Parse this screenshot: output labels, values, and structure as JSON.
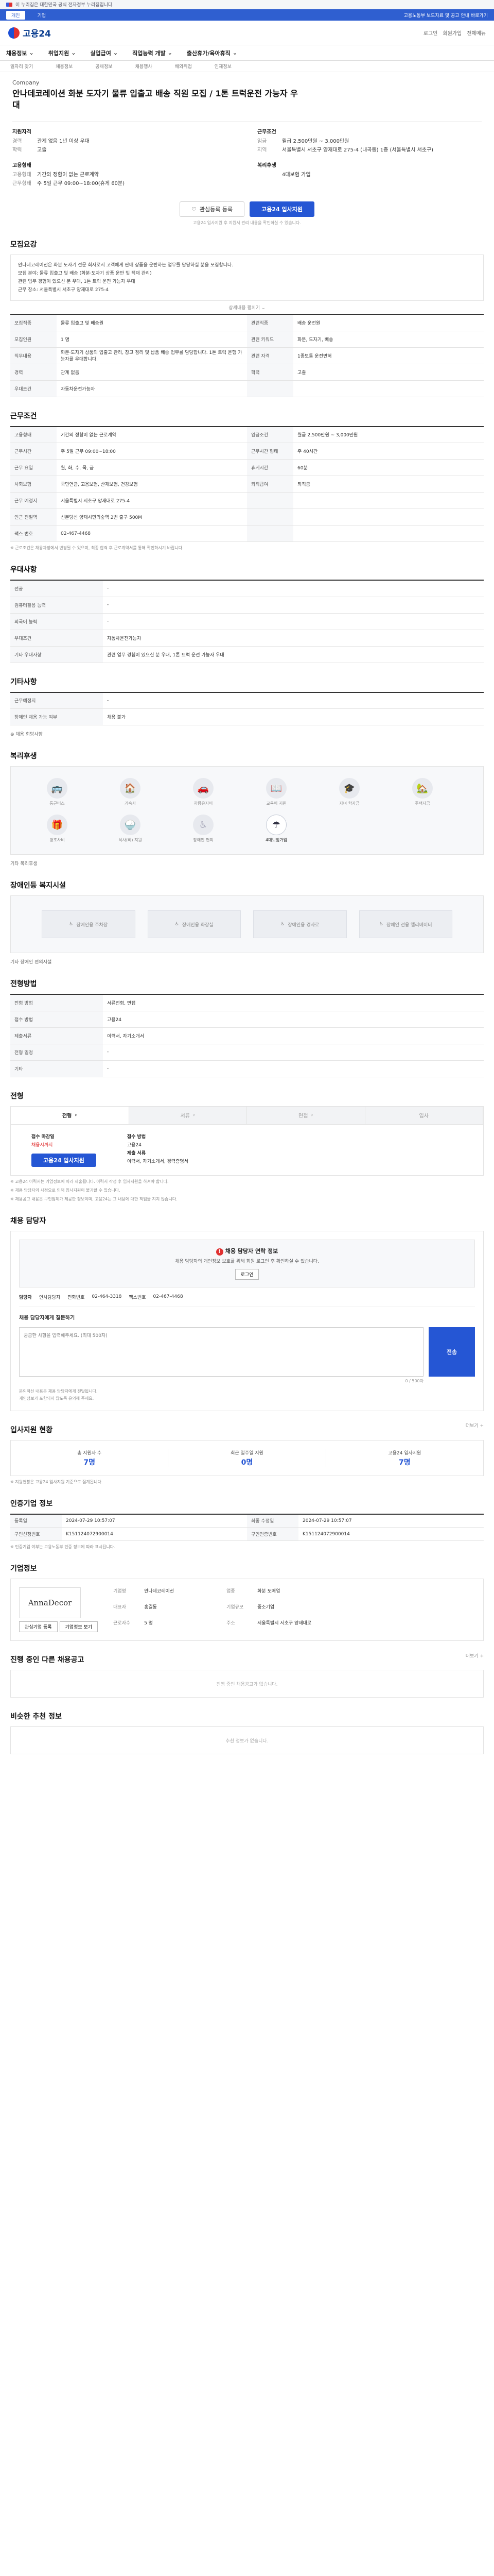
{
  "gov": {
    "notice": "이 누리집은 대한민국 공식 전자정부 누리집입니다."
  },
  "notice_bar": {
    "tabs": [
      "개인",
      "기업"
    ],
    "right": "고용노동부 보도자료 및 공고 안내 바로가기"
  },
  "header": {
    "logo": "고용24",
    "links": [
      "로그인",
      "회원가입",
      "전체메뉴"
    ]
  },
  "gnb": [
    "채용정보",
    "취업지원",
    "실업급여",
    "직업능력 개발",
    "출산휴가/육아휴직"
  ],
  "subnav": [
    "일자리 찾기",
    "채용정보",
    "공채정보",
    "채용행사",
    "해외취업",
    "인재정보"
  ],
  "job": {
    "company": "Company",
    "title": "안나데코레이션 화분 도자기 물류 입출고 배송 직원 모집 / 1톤 트럭운전 가능자 우대"
  },
  "summary": {
    "left": [
      {
        "head": "지원자격",
        "rows": [
          [
            "경력",
            "관계 없음 1년 이상 우대"
          ],
          [
            "학력",
            "고졸"
          ]
        ]
      },
      {
        "head": "고용형태",
        "rows": [
          [
            "고용형태",
            "기간의 정함이 없는 근로계약"
          ],
          [
            "근무형태",
            "주 5일 근무 09:00~18:00(휴게 60분)"
          ]
        ]
      }
    ],
    "right": [
      {
        "head": "근무조건",
        "rows": [
          [
            "임금",
            "월급 2,500만원 ~ 3,000만원"
          ],
          [
            "지역",
            "서울특별시 서초구 양재대로 275-4 (내곡동) 1층 (서울특별시 서초구)"
          ]
        ]
      },
      {
        "head": "복리후생",
        "rows": [
          [
            "",
            "4대보험 가입"
          ]
        ]
      }
    ]
  },
  "actions": {
    "favorite": "관심등록 등록",
    "apply": "고용24 입사지원",
    "note": "고용24 입사지원 후 지원서 관리 내용을 확인하실 수 있습니다."
  },
  "sections": {
    "recruit": "모집요강",
    "work": "근무조건",
    "prefer": "우대사항",
    "etc": "기타사항",
    "welfare": "복리후생",
    "disabled": "장애인등 복지시설",
    "process": "전형방법",
    "contact": "채용 담당자",
    "stats": "입사지원 현황",
    "info": "인증기업 정보",
    "company": "기업정보",
    "same": "진행 중인 다른 채용공고",
    "similar": "비슷한 추천 정보"
  },
  "recruit_detail": {
    "lines": [
      "안나데코레이션은 화분 도자기 전문 회사로서 고객에게 판매 상품을 운반하는 업무를 담당하실 분을 모집합니다.",
      "모집 분야: 물류 입출고 및 배송 (화분·도자기 상품 운반 및 적재 관리)",
      "관련 업무 경험이 있으신 분 우대, 1톤 트럭 운전 가능자 우대",
      "근무 장소: 서울특별시 서초구 양재대로 275-4"
    ],
    "expand": "상세내용 펼치기"
  },
  "recruit_table": [
    [
      [
        "모집직종",
        "물류 입출고 및 배송원"
      ],
      [
        "관련직종",
        "배송 운전원"
      ]
    ],
    [
      [
        "모집인원",
        "1 명"
      ],
      [
        "관련 키워드",
        "화분, 도자기, 배송"
      ]
    ],
    [
      [
        "직무내용",
        "화분·도자기 상품의 입출고 관리, 창고 정리 및 납품 배송 업무를 담당합니다. 1톤 트럭 운행 가능자를 우대합니다."
      ],
      [
        "관련 자격",
        "1종보통 운전면허"
      ]
    ],
    [
      [
        "경력",
        "관계 없음"
      ],
      [
        "학력",
        "고졸"
      ]
    ],
    [
      [
        "우대조건",
        "자동차운전가능자"
      ],
      [
        "",
        ""
      ]
    ]
  ],
  "work_table": [
    [
      [
        "고용형태",
        "기간의 정함이 없는 근로계약"
      ],
      [
        "임금조건",
        "월급 2,500만원 ~ 3,000만원"
      ]
    ],
    [
      [
        "근무시간",
        "주 5일 근무 09:00~18:00"
      ],
      [
        "근무시간 형태",
        "주 40시간"
      ]
    ],
    [
      [
        "근무 요일",
        "월, 화, 수, 목, 금"
      ],
      [
        "휴게시간",
        "60분"
      ]
    ],
    [
      [
        "사회보험",
        "국민연금, 고용보험, 산재보험, 건강보험"
      ],
      [
        "퇴직급여",
        "퇴직금"
      ]
    ],
    [
      [
        "근무 예정지",
        "서울특별시 서초구 양재대로 275-4"
      ],
      [
        "",
        ""
      ]
    ],
    [
      [
        "인근 전철역",
        "신분당선 양재시민의숲역 2번 출구 500M"
      ],
      [
        "",
        ""
      ]
    ],
    [
      [
        "팩스 번호",
        "02-467-4468"
      ],
      [
        "",
        ""
      ]
    ]
  ],
  "work_note": "※ 근로조건은 채용과정에서 변경될 수 있으며, 최종 합격 후 근로계약서를 통해 확인하시기 바랍니다.",
  "prefer_table": [
    [
      [
        "전공",
        "-"
      ]
    ],
    [
      [
        "컴퓨터활용 능력",
        "-"
      ]
    ],
    [
      [
        "외국어 능력",
        "-"
      ]
    ],
    [
      [
        "우대조건",
        "자동차운전가능자"
      ]
    ],
    [
      [
        "기타 우대사항",
        "관련 업무 경험이 있으신 분 우대, 1톤 트럭 운전 가능자 우대"
      ]
    ]
  ],
  "etc_table": [
    [
      [
        "근무예정지",
        "-"
      ]
    ],
    [
      [
        "장애인 채용 가능 여부",
        "채용 불가"
      ]
    ]
  ],
  "etc_link": "채용 희망사항",
  "welfare_icons": [
    {
      "label": "통근버스",
      "icon": "bus-icon",
      "glyph": "🚌",
      "on": false
    },
    {
      "label": "기숙사",
      "icon": "dorm-icon",
      "glyph": "🏠",
      "on": false
    },
    {
      "label": "차량유지비",
      "icon": "car-icon",
      "glyph": "🚗",
      "on": false
    },
    {
      "label": "교육비 지원",
      "icon": "book-icon",
      "glyph": "📖",
      "on": false
    },
    {
      "label": "자녀 학자금",
      "icon": "cap-icon",
      "glyph": "🎓",
      "on": false
    },
    {
      "label": "주택자금",
      "icon": "house-icon",
      "glyph": "🏡",
      "on": false
    },
    {
      "label": "경조사비",
      "icon": "gift-icon",
      "glyph": "🎁",
      "on": false
    },
    {
      "label": "식사(비) 지원",
      "icon": "meal-icon",
      "glyph": "🍚",
      "on": false
    },
    {
      "label": "장애인 편의",
      "icon": "accessible-icon",
      "glyph": "♿",
      "on": false
    },
    {
      "label": "4대보험가입",
      "icon": "insurance-icon",
      "glyph": "☂",
      "on": true
    }
  ],
  "welfare_etc": "기타 복리후생",
  "facilities": [
    "장애인용 주차장",
    "장애인용 화장실",
    "장애인용 경사로",
    "장애인 전용 엘리베이터"
  ],
  "facilities_etc": "기타 장애인 편의시설",
  "process_table": [
    [
      [
        "전형 방법",
        "서류전형, 면접"
      ]
    ],
    [
      [
        "접수 방법",
        "고용24"
      ]
    ],
    [
      [
        "제출서류",
        "이력서, 자기소개서"
      ]
    ],
    [
      [
        "전형 일정",
        "-"
      ]
    ],
    [
      [
        "기타",
        "-"
      ]
    ]
  ],
  "apply_tabs": [
    "전형",
    "서류",
    "면접",
    "입사"
  ],
  "apply": {
    "h1": "접수 마감일",
    "v1": "채용시까지",
    "h2": "접수 방법",
    "v2": "고용24",
    "h3": "제출 서류",
    "v3": "이력서, 자기소개서, 경력증명서",
    "btn": "고용24 입사지원"
  },
  "apply_notes": [
    "※ 고용24 이력서는 기업정보에 따라 제출됩니다. 이력서 작성 후 입사지원을 하셔야 합니다.",
    "※ 채용 담당자의 사정으로 인해 입사지원이 불가할 수 있습니다.",
    "※ 채용공고 내용은 구인업체가 제공한 정보이며, 고용24는 그 내용에 대한 책임을 지지 않습니다."
  ],
  "contact": {
    "alert_title": "채용 담당자 연락 정보",
    "alert_text": "채용 담당자의 개인정보 보호를 위해 회원 로그인 후 확인하실 수 있습니다.",
    "login_btn": "로그인",
    "name_label": "담당자",
    "name": "인사담당자",
    "phone_label": "전화번호",
    "phone": "02-464-3318",
    "fax_label": "팩스번호",
    "fax": "02-467-4468",
    "ask_title": "채용 담당자에게 질문하기",
    "ask_placeholder": "궁금한 사항을 입력해주세요. (최대 500자)",
    "ask_count": "0 / 500자",
    "ask_btn": "전송",
    "bullets": [
      "문의하신 내용은 채용 담당자에게 전달됩니다.",
      "개인정보가 포함되지 않도록 유의해 주세요."
    ]
  },
  "stats": [
    {
      "label": "총 지원자 수",
      "num": "7명"
    },
    {
      "label": "최근 일주일 지원",
      "num": "0명"
    },
    {
      "label": "고용24 입사지원",
      "num": "7명"
    }
  ],
  "stats_note": "※ 지원현황은 고용24 입사지원 기준으로 집계됩니다.",
  "info_table": [
    [
      [
        "등록일",
        "2024-07-29 10:57:07"
      ],
      [
        "최종 수정일",
        "2024-07-29 10:57:07"
      ]
    ],
    [
      [
        "구인신청번호",
        "K151124072900014"
      ],
      [
        "구인인증번호",
        "K151124072900014"
      ]
    ]
  ],
  "info_note": "※ 인증기업 여부는 고용노동부 인증 정보에 따라 표시됩니다.",
  "company": {
    "logo_text": "AnnaDecor",
    "rows": [
      [
        "기업명",
        "안나데코레이션"
      ],
      [
        "업종",
        "화분 도매업"
      ],
      [
        "대표자",
        "홍길동"
      ],
      [
        "기업규모",
        "중소기업"
      ],
      [
        "근로자수",
        "5 명"
      ],
      [
        "주소",
        "서울특별시 서초구 양재대로"
      ]
    ],
    "btns": [
      "관심기업 등록",
      "기업정보 보기"
    ]
  },
  "same_empty": "진행 중인 채용공고가 없습니다.",
  "similar_empty": "추천 정보가 없습니다.",
  "more": "더보기 +"
}
